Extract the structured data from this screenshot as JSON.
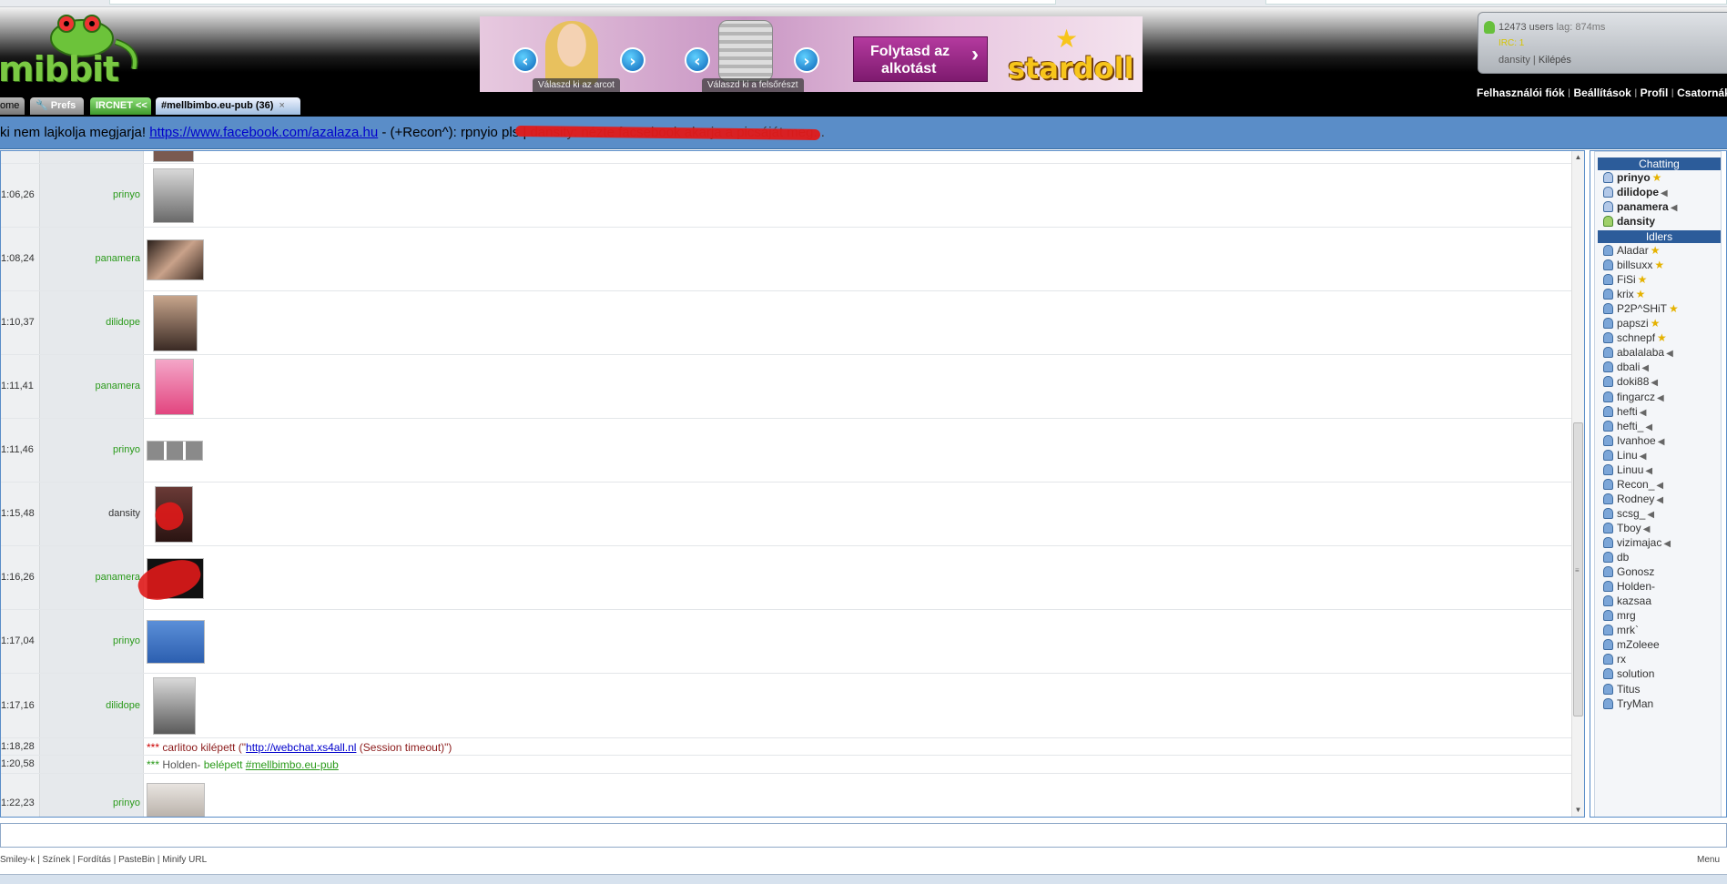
{
  "brand": {
    "logo_text": "mibbit"
  },
  "ad": {
    "caption_face": "Válaszd ki az arcot",
    "caption_top": "Válaszd ki a felsőrészt",
    "cta_line1": "Folytasd az",
    "cta_line2": "alkotást",
    "brand": "stardoll"
  },
  "userbox": {
    "users": "12473 users",
    "lag": "lag: 874ms",
    "irc": "IRC: 1",
    "nick": "dansity",
    "logout": "Kilépés"
  },
  "toplinks": [
    "Felhasználói fiók",
    "Beállítások",
    "Profil",
    "Csatornák"
  ],
  "tabs": {
    "home": "ome",
    "prefs": "Prefs",
    "ircnet": "IRCNET <<",
    "channel": "#mellbimbo.eu-pub (36)",
    "close": "×",
    "nav": "< >"
  },
  "topic": {
    "prefix": "ki nem lajkolja megjarja! ",
    "link": "https://www.facebook.com/azalaza.hu",
    "middle": " - (+Recon^): rpnyio pls | ",
    "hidden": "dansity: nézte facsebook akarja a picsáját meg...",
    "suffix": "..."
  },
  "messages": [
    {
      "time": "1:06,26",
      "nick": "prinyo",
      "nick_color": "#2a9a1a"
    },
    {
      "time": "1:08,24",
      "nick": "panamera",
      "nick_color": "#2a9a1a"
    },
    {
      "time": "1:10,37",
      "nick": "dilidope",
      "nick_color": "#2a9a1a"
    },
    {
      "time": "1:11,41",
      "nick": "panamera",
      "nick_color": "#2a9a1a"
    },
    {
      "time": "1:11,46",
      "nick": "prinyo",
      "nick_color": "#2a9a1a"
    },
    {
      "time": "1:15,48",
      "nick": "dansity",
      "nick_color": "#333333"
    },
    {
      "time": "1:16,26",
      "nick": "panamera",
      "nick_color": "#2a9a1a"
    },
    {
      "time": "1:17,04",
      "nick": "prinyo",
      "nick_color": "#2a9a1a"
    },
    {
      "time": "1:17,16",
      "nick": "dilidope",
      "nick_color": "#2a9a1a"
    }
  ],
  "events": {
    "quit": {
      "time": "1:18,28",
      "stars": "***",
      "nick": "carlitoo",
      "verb": "kilépett",
      "open": "(\"",
      "link": "http://webchat.xs4all.nl",
      "reason": " (Session timeout)\")"
    },
    "join": {
      "time": "1:20,58",
      "stars": "***",
      "nick": "Holden-",
      "verb": "belépett",
      "channel": "#mellbimbo.eu-pub"
    },
    "last": {
      "time": "1:22,23",
      "nick": "prinyo"
    }
  },
  "userlist": {
    "chatting_label": "Chatting",
    "idlers_label": "Idlers",
    "chatting": [
      {
        "nick": "prinyo",
        "badge": "star"
      },
      {
        "nick": "dilidope",
        "badge": "mute"
      },
      {
        "nick": "panamera",
        "badge": "mute"
      },
      {
        "nick": "dansity",
        "badge": "none"
      }
    ],
    "idlers": [
      {
        "nick": "Aladar",
        "badge": "star"
      },
      {
        "nick": "billsuxx",
        "badge": "star"
      },
      {
        "nick": "FiSi",
        "badge": "star"
      },
      {
        "nick": "krix",
        "badge": "star"
      },
      {
        "nick": "P2P^SHiT",
        "badge": "star"
      },
      {
        "nick": "papszi",
        "badge": "star"
      },
      {
        "nick": "schnepf",
        "badge": "star"
      },
      {
        "nick": "abalalaba",
        "badge": "mute"
      },
      {
        "nick": "dbali",
        "badge": "mute"
      },
      {
        "nick": "doki88",
        "badge": "mute"
      },
      {
        "nick": "fingarcz",
        "badge": "mute"
      },
      {
        "nick": "hefti",
        "badge": "mute"
      },
      {
        "nick": "hefti_",
        "badge": "mute"
      },
      {
        "nick": "Ivanhoe",
        "badge": "mute"
      },
      {
        "nick": "Linu",
        "badge": "mute"
      },
      {
        "nick": "Linuu",
        "badge": "mute"
      },
      {
        "nick": "Recon_",
        "badge": "mute"
      },
      {
        "nick": "Rodney",
        "badge": "mute"
      },
      {
        "nick": "scsg_",
        "badge": "mute"
      },
      {
        "nick": "Tboy",
        "badge": "mute"
      },
      {
        "nick": "vizimajac",
        "badge": "mute"
      },
      {
        "nick": "db",
        "badge": "none"
      },
      {
        "nick": "Gonosz",
        "badge": "none"
      },
      {
        "nick": "Holden-",
        "badge": "none"
      },
      {
        "nick": "kazsaa",
        "badge": "none"
      },
      {
        "nick": "mrg",
        "badge": "none"
      },
      {
        "nick": "mrk`",
        "badge": "none"
      },
      {
        "nick": "mZoleee",
        "badge": "none"
      },
      {
        "nick": "rx",
        "badge": "none"
      },
      {
        "nick": "solution",
        "badge": "none"
      },
      {
        "nick": "Titus",
        "badge": "none"
      },
      {
        "nick": "TryMan",
        "badge": "none"
      }
    ]
  },
  "bottom": {
    "links": [
      "Smiley-k",
      "Színek",
      "Fordítás",
      "PasteBin",
      "Minify URL"
    ],
    "menu": "Menu"
  },
  "colors": {
    "topic_bg": "#5a8dc8",
    "section_header": "#2c5c9a",
    "nick_green": "#2a9a1a"
  }
}
